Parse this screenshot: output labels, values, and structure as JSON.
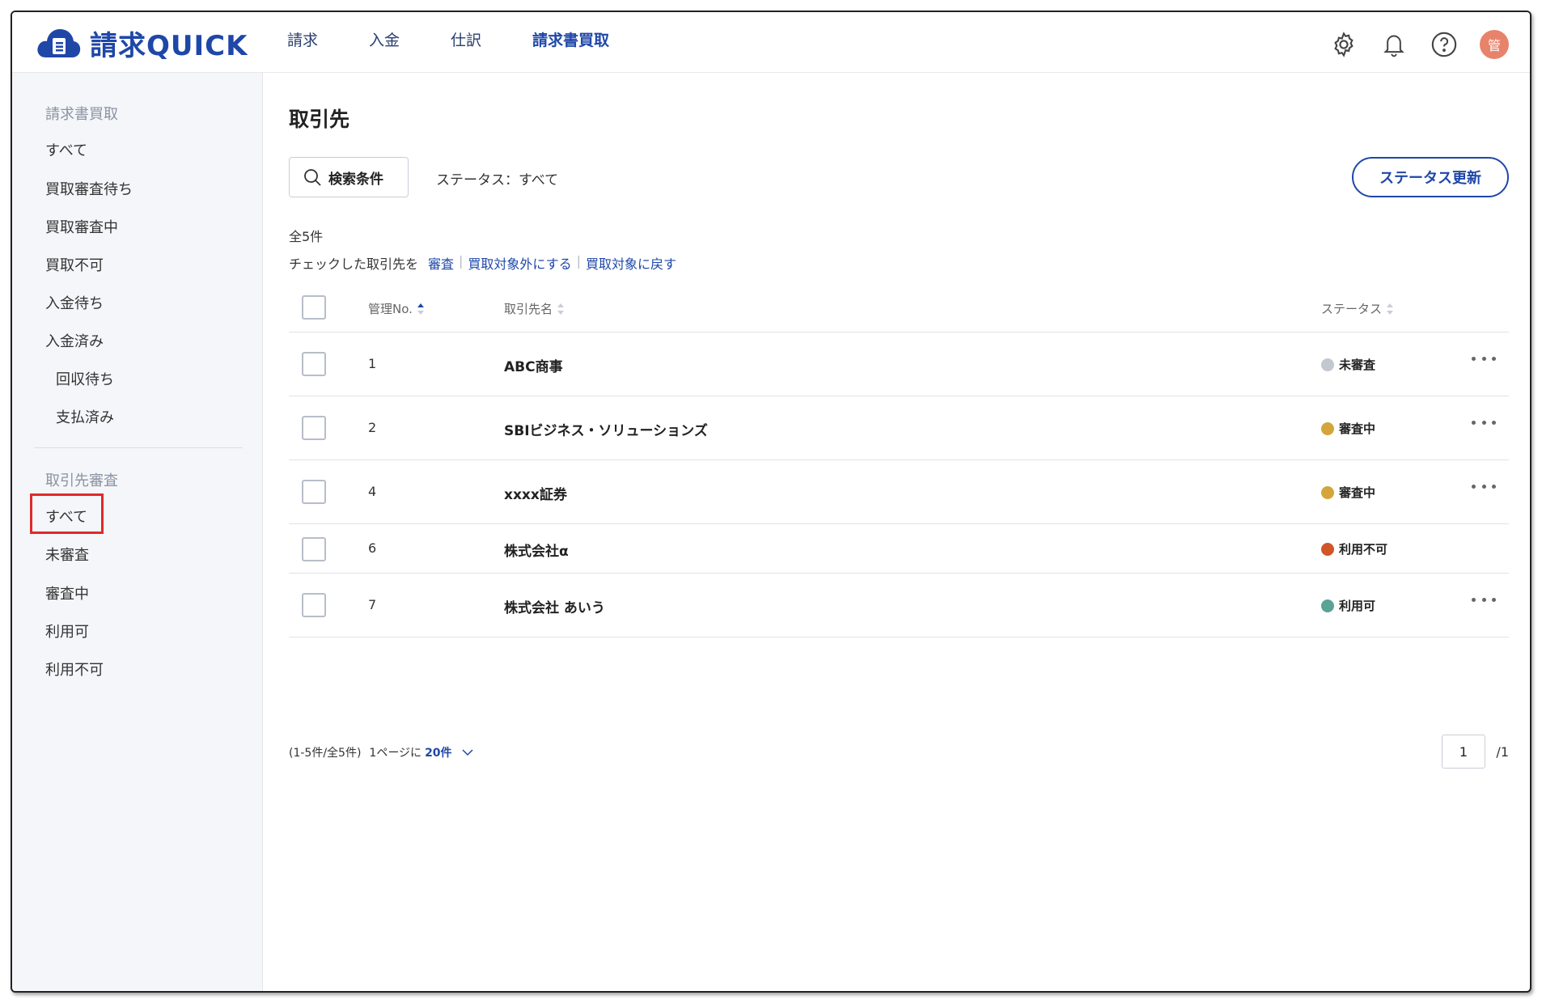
{
  "app": {
    "name": "請求QUICK"
  },
  "nav": {
    "items": [
      {
        "label": "請求",
        "active": false
      },
      {
        "label": "入金",
        "active": false
      },
      {
        "label": "仕訳",
        "active": false
      },
      {
        "label": "請求書買取",
        "active": true
      }
    ]
  },
  "header_icons": [
    "gear-icon",
    "bell-icon",
    "help-icon"
  ],
  "user": {
    "avatar_label": "管",
    "avatar_color": "#e8836b"
  },
  "sidebar": {
    "section1": {
      "title": "請求書買取",
      "items": [
        "すべて",
        "買取審査待ち",
        "買取審査中",
        "買取不可",
        "入金待ち",
        "入金済み",
        "回収待ち",
        "支払済み"
      ]
    },
    "section2": {
      "title": "取引先審査",
      "items": [
        "すべて",
        "未審査",
        "審査中",
        "利用可",
        "利用不可"
      ],
      "selected": "すべて"
    }
  },
  "main": {
    "title": "取引先",
    "search_button": "検索条件",
    "status_filter": "ステータス：すべて",
    "status_update_button": "ステータス更新",
    "total": "全5件",
    "bulk": {
      "lead": "チェックした取引先を",
      "actions": [
        "審査",
        "買取対象外にする",
        "買取対象に戻す"
      ]
    },
    "table": {
      "headers": {
        "no": "管理No.",
        "name": "取引先名",
        "status": "ステータス"
      },
      "rows": [
        {
          "no": "1",
          "name": "ABC商事",
          "status": "未審査",
          "status_color": "#c3c7cf",
          "has_menu": true
        },
        {
          "no": "2",
          "name": "SBIビジネス・ソリューションズ",
          "status": "審査中",
          "status_color": "#d4a53a",
          "has_menu": true
        },
        {
          "no": "4",
          "name": "xxxx証券",
          "status": "審査中",
          "status_color": "#d4a53a",
          "has_menu": true
        },
        {
          "no": "6",
          "name": "株式会社α",
          "status": "利用不可",
          "status_color": "#d0562a",
          "has_menu": false
        },
        {
          "no": "7",
          "name": "株式会社 あいう",
          "status": "利用可",
          "status_color": "#5aa396",
          "has_menu": true
        }
      ]
    },
    "pager": {
      "range": "(1-5件/全5件)",
      "per_page_label": "1ページに",
      "per_page_value": "20件",
      "current_page": "1",
      "total_pages": "/1"
    }
  },
  "colors": {
    "brand": "#1f47a8",
    "highlight": "#e0292c"
  }
}
